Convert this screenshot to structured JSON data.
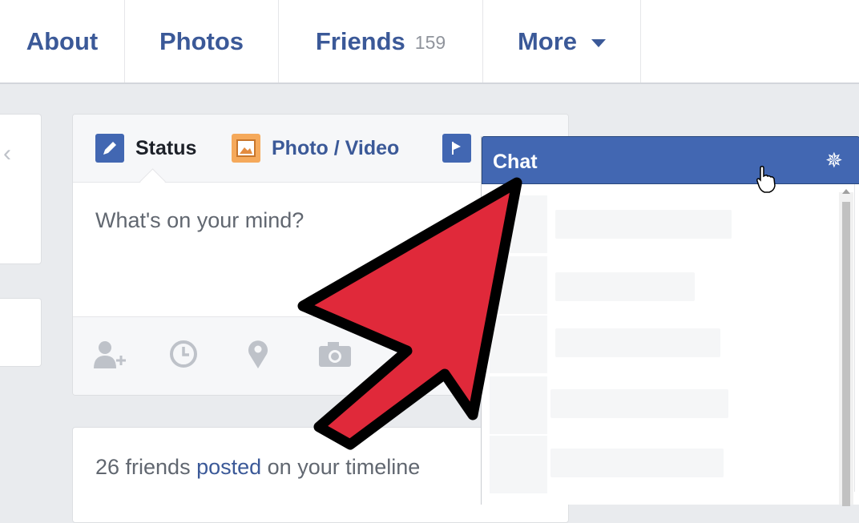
{
  "nav": {
    "tabs": [
      {
        "label": "About"
      },
      {
        "label": "Photos"
      },
      {
        "label": "Friends",
        "count": "159"
      },
      {
        "label": "More"
      }
    ]
  },
  "composer": {
    "status_label": "Status",
    "photo_label": "Photo / Video",
    "placeholder": "What's on your mind?",
    "footer_icons": [
      "tag-friends-icon",
      "clock-icon",
      "location-pin-icon",
      "camera-icon"
    ]
  },
  "posted": {
    "prefix": "26 friends ",
    "link": "posted",
    "suffix": " on your timeline"
  },
  "chat": {
    "title": "Chat",
    "gear_icon": "gear-icon"
  },
  "colors": {
    "brand": "#3b5998",
    "chat_header": "#4267b2",
    "arrow": "#e0293a"
  }
}
